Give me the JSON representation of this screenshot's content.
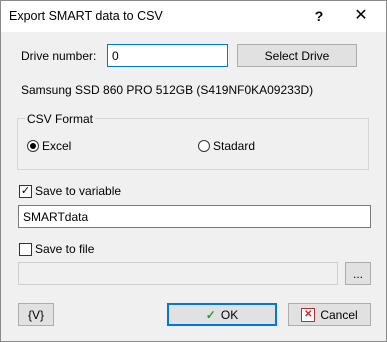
{
  "window": {
    "title": "Export SMART data to CSV",
    "help_glyph": "?",
    "close_glyph": "✕"
  },
  "drive": {
    "label": "Drive number:",
    "value": "0",
    "select_button": "Select Drive",
    "model": "Samsung SSD 860 PRO 512GB (S419NF0KA09233D)"
  },
  "csv_format": {
    "label": "CSV Format",
    "options": [
      {
        "label": "Excel",
        "checked": true
      },
      {
        "label": "Stadard",
        "checked": false
      }
    ]
  },
  "save_to_variable": {
    "label": "Save to variable",
    "checked": true,
    "value": "SMARTdata"
  },
  "save_to_file": {
    "label": "Save to file",
    "checked": false,
    "value": "",
    "browse_label": "..."
  },
  "footer": {
    "variables_button": "{V}",
    "ok_label": "OK",
    "cancel_label": "Cancel",
    "check_glyph": "✓",
    "cancel_glyph": "✕"
  }
}
